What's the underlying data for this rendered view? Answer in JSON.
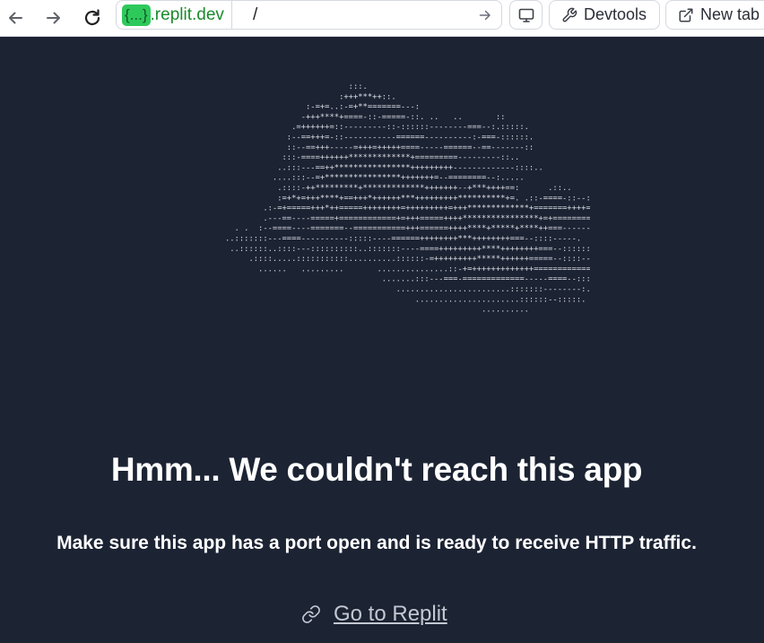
{
  "browser": {
    "url_host_badge": "{...}",
    "url_host_suffix": ".replit.dev",
    "url_path": "/",
    "devtools_label": "Devtools",
    "new_tab_label": "New tab"
  },
  "error_page": {
    "headline": "Hmm... We couldn't reach this app",
    "message": "Make sure this app has a port open and is ready to receive HTTP traffic.",
    "link_label": "Go to Replit"
  },
  "ascii_art": [
    "                                    :::.",
    "                                  :+++***++::.",
    "                           :-=+=..:-=+**=======---:",
    "                          -+++****+====-::-=====-::. ..   ..       ::",
    "                        .=++++++=::---------::-::::::--------===--:.:::::.",
    "                       :--==+++=-::-----------======----------:-===-::::::.",
    "                       ::--==+++-----=+++=+++++====-----======--==-------::",
    "                      :::-====++++++*************+=========---------::..",
    "                     ..:::---==++****************+++++++++-------------::::..",
    "                    ....:::--=+****************+++++++=--========--:.....",
    "                     .::::-++*********+*************+++++++--+***++++==:      .::..",
    "                     :=+*+=+++****+==+++*++++++***+++++++++**********+=. .::-====-::--:",
    "                  .:-=+=====+++*++=====++++++++=+++++++++=+++*************+=======++++==-.",
    "                  .---==----=====+============+=+++=====++++****************+=+========-:.",
    "            . .  :--====----=======--===========+++======++++****+*****+****++===------====-.",
    "          ..:::::::---====----------:::::----======++++++++***++++++++===--::::-----.",
    "           ..::::::..::::---::::::::::..:::::::----====+++++++++****++++++++===--::::::::---:",
    "               .::::.....:::::::::::..........::::::-=+++++++++*****++++++=====--::::--::.",
    "                 ......   .........       ...............::-+=+++++++++++++=============-----:::..:",
    "                                           .......:::---===-=============-----====--::::::::..",
    "                                              ........................:::::::--------:.   ..",
    "                                                  ......................::::::--:::::.",
    "                                                                .........."
  ]
}
